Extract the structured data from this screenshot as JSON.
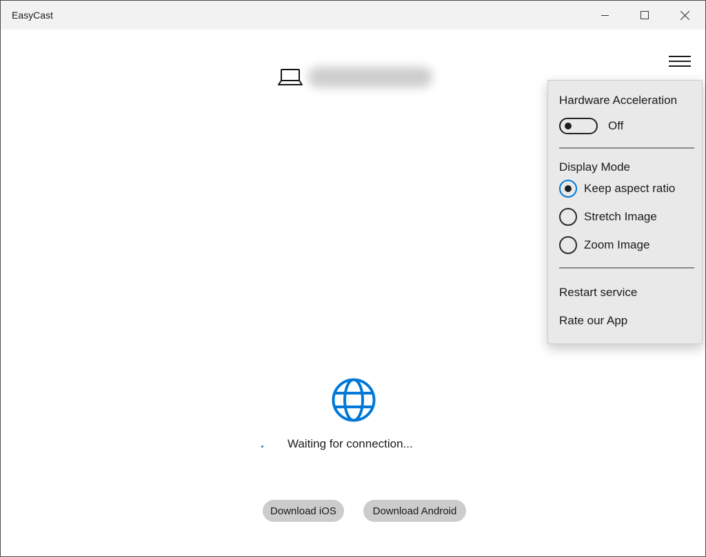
{
  "window": {
    "title": "EasyCast",
    "controls": {
      "minimize": "minimize-icon",
      "maximize": "maximize-icon",
      "close": "close-icon"
    }
  },
  "header": {
    "menu_icon": "hamburger-menu-icon",
    "device_icon": "laptop-icon",
    "device_name_redacted": true
  },
  "settings_menu": {
    "hardware_acceleration": {
      "label": "Hardware Acceleration",
      "enabled": false,
      "state_label": "Off"
    },
    "display_mode": {
      "label": "Display Mode",
      "selected": "Keep aspect ratio",
      "options": [
        {
          "label": "Keep aspect ratio",
          "checked": true
        },
        {
          "label": "Stretch Image",
          "checked": false
        },
        {
          "label": "Zoom Image",
          "checked": false
        }
      ]
    },
    "actions": [
      {
        "label": "Restart service"
      },
      {
        "label": "Rate our App"
      }
    ]
  },
  "main": {
    "status_icon": "globe-icon",
    "status_text": "Waiting for connection...",
    "buttons": {
      "ios": "Download iOS",
      "android": "Download Android"
    }
  },
  "colors": {
    "accent": "#0078d7",
    "titlebar_bg": "#f2f2f2",
    "flyout_bg": "#e9e9e9",
    "pill_bg": "#cccccc"
  }
}
